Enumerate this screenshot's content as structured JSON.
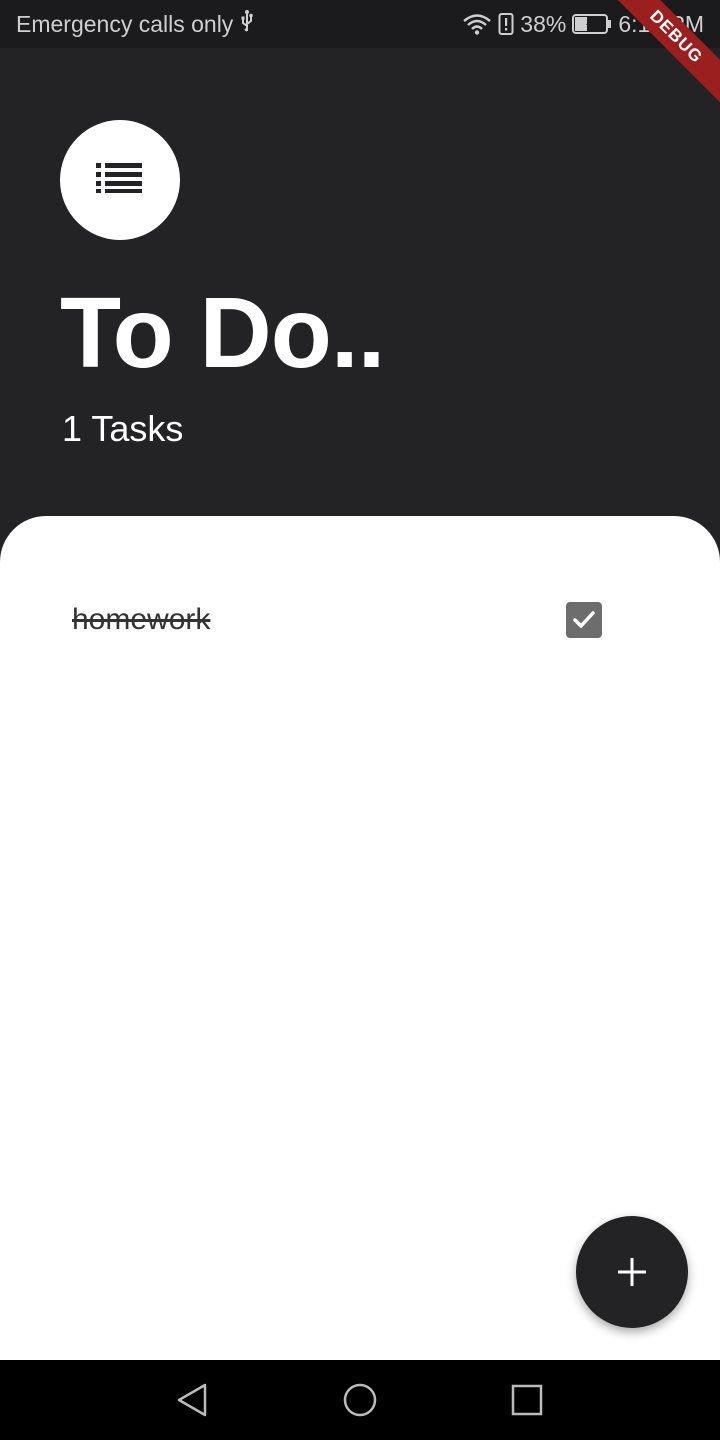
{
  "status_bar": {
    "carrier_text": "Emergency calls only",
    "battery_percent": "38%",
    "time": "6:12 PM",
    "icons": [
      "usb-icon",
      "wifi-icon",
      "battery-alert-icon",
      "battery-charging-icon"
    ]
  },
  "debug_banner": "DEBUG",
  "header": {
    "icon": "list-icon",
    "title": "To Do..",
    "task_count": "1 Tasks"
  },
  "tasks": [
    {
      "name": "homework",
      "completed": true
    }
  ],
  "fab": {
    "icon": "add-icon"
  },
  "nav_bar": {
    "icons": [
      "back-icon",
      "home-icon",
      "recents-icon"
    ]
  },
  "colors": {
    "background": "#232325",
    "card": "#ffffff",
    "checkbox": "#6d6d6d",
    "debug_banner": "#9c1f1f"
  }
}
